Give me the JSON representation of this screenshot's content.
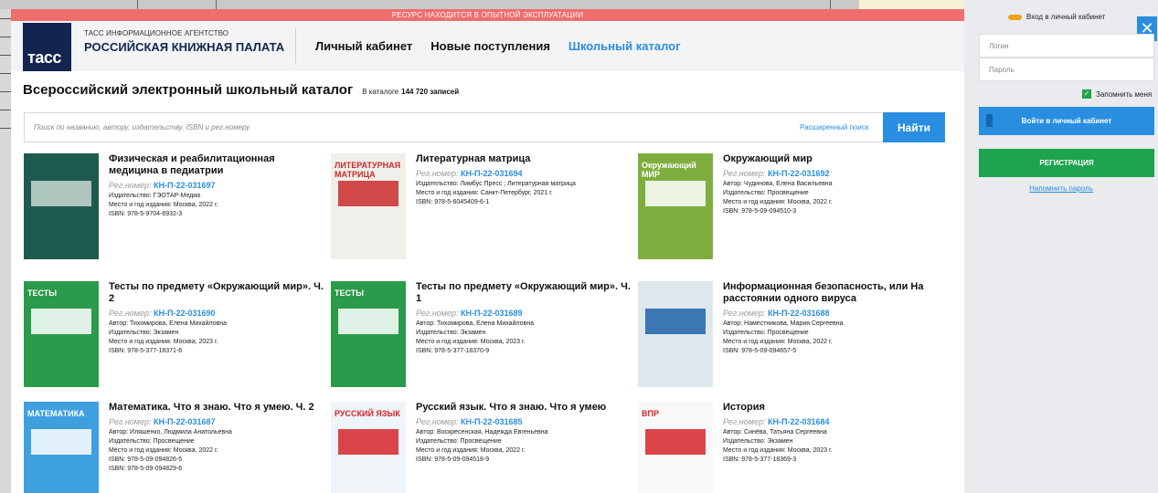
{
  "banner": "РЕСУРС НАХОДИТСЯ В ОПЫТНОЙ ЭКСПЛУАТАЦИИ",
  "logo": {
    "text": "тасс",
    "org_small": "ТАСС ИНФОРМАЦИОННОЕ АГЕНТСТВО",
    "org_big": "РОССИЙСКАЯ КНИЖНАЯ ПАЛАТА"
  },
  "nav": {
    "cabinet": "Личный кабинет",
    "new": "Новые поступления",
    "school": "Школьный каталог"
  },
  "catalog": {
    "title": "Всероссийский электронный школьный каталог",
    "count_label": "В каталоге",
    "count_value": "144 720 записей"
  },
  "search": {
    "placeholder": "Поиск по названию, автору, издательству, ISBN и рег.номеру",
    "advanced": "Расширенный поиск",
    "button": "Найти"
  },
  "books": [
    {
      "title": "Физическая и реабилитационная медицина в педиатрии",
      "reg_label": "Рег.номер:",
      "reg": "КН-П-22-031697",
      "lines": [
        "Издательство: ГЭОТАР-Медиа",
        "Место и год издания: Москва, 2022 г.",
        "ISBN:  978-5-9704-6932-3"
      ]
    },
    {
      "title": "Литературная матрица",
      "reg_label": "Рег.номер:",
      "reg": "КН-П-22-031694",
      "lines": [
        "Издательство: Лимбус Пресс ; Литературная матрица",
        "Место и год издания: Санкт-Петербург, 2021 г.",
        "ISBN:  978-5-6045409-6-1"
      ]
    },
    {
      "title": "Окружающий мир",
      "reg_label": "Рег.номер:",
      "reg": "КН-П-22-031692",
      "lines": [
        "Автор: Чудинова, Елена Васильевна",
        "Издательство: Просвещение",
        "Место и год издания: Москва, 2022 г.",
        "ISBN:  978-5-09-094510-3"
      ]
    },
    {
      "title": "Тесты по предмету «Окружающий мир». Ч. 2",
      "reg_label": "Рег.номер:",
      "reg": "КН-П-22-031690",
      "lines": [
        "Автор: Тихомирова, Елена Михайловна",
        "Издательство: Экзамен",
        "Место и год издания: Москва, 2023 г.",
        "ISBN:  978-5-377-18371-6"
      ]
    },
    {
      "title": "Тесты по предмету «Окружающий мир». Ч. 1",
      "reg_label": "Рег.номер:",
      "reg": "КН-П-22-031689",
      "lines": [
        "Автор: Тихомирова, Елена Михайловна",
        "Издательство: Экзамен",
        "Место и год издания: Москва, 2023 г.",
        "ISBN:  978-5-377-18370-9"
      ]
    },
    {
      "title": "Информационная безопасность, или На расстоянии одного вируса",
      "reg_label": "Рег.номер:",
      "reg": "КН-П-22-031688",
      "lines": [
        "Автор: Наместникова, Мария Сергеевна",
        "Издательство: Просвещение",
        "Место и год издания: Москва, 2022 г.",
        "ISBN:  978-5-09-094657-5"
      ]
    },
    {
      "title": "Математика. Что я знаю. Что я умею. Ч. 2",
      "reg_label": "Рег.номер:",
      "reg": "КН-П-22-031687",
      "lines": [
        "Автор: Иляшенко, Людмила Анатольевна",
        "Издательство: Просвещение",
        "Место и год издания: Москва, 2022 г.",
        "ISBN:  978-5-09-094826-5",
        "ISBN:  978-5-09-094829-6"
      ]
    },
    {
      "title": "Русский язык. Что я знаю. Что я умею",
      "reg_label": "Рег.номер:",
      "reg": "КН-П-22-031685",
      "lines": [
        "Автор: Воскресенская, Надежда Евгеньевна",
        "Издательство: Просвещение",
        "Место и год издания: Москва, 2022 г.",
        "ISBN:  978-5-09-094518-9"
      ]
    },
    {
      "title": "История",
      "reg_label": "Рег.номер:",
      "reg": "КН-П-22-031684",
      "lines": [
        "Автор: Синёва, Татьяна Сергеевна",
        "Издательство: Экзамен",
        "Место и год издания: Москва, 2023 г.",
        "ISBN:  978-5-377-18369-3"
      ]
    }
  ],
  "covers": [
    {
      "bg": "#1e5a4d",
      "accent": "#c9d9d2",
      "label": ""
    },
    {
      "bg": "#f1efe9",
      "accent": "#c92b2b",
      "label": "ЛИТЕРАТУРНАЯ МАТРИЦА"
    },
    {
      "bg": "#7fae3f",
      "accent": "#ffffff",
      "label": "Окружающий МИР"
    },
    {
      "bg": "#2b9a4a",
      "accent": "#ffffff",
      "label": "ТЕСТЫ"
    },
    {
      "bg": "#2b9a4a",
      "accent": "#ffffff",
      "label": "ТЕСТЫ"
    },
    {
      "bg": "#dde7ec",
      "accent": "#1f63a8",
      "label": ""
    },
    {
      "bg": "#3fa0e0",
      "accent": "#ffffff",
      "label": "МАТЕМАТИКА"
    },
    {
      "bg": "#eef4f8",
      "accent": "#d6262b",
      "label": "РУССКИЙ ЯЗЫК"
    },
    {
      "bg": "#f8f8f8",
      "accent": "#d6262b",
      "label": "ВПР"
    }
  ],
  "login": {
    "header": "Вход в личный кабинет",
    "login_placeholder": "Логин",
    "password_placeholder": "Пароль",
    "remember": "Запомнить меня",
    "enter_button": "Войти в личный кабинет",
    "register_button": "РЕГИСТРАЦИЯ",
    "remind": "Напомнить пароль"
  }
}
